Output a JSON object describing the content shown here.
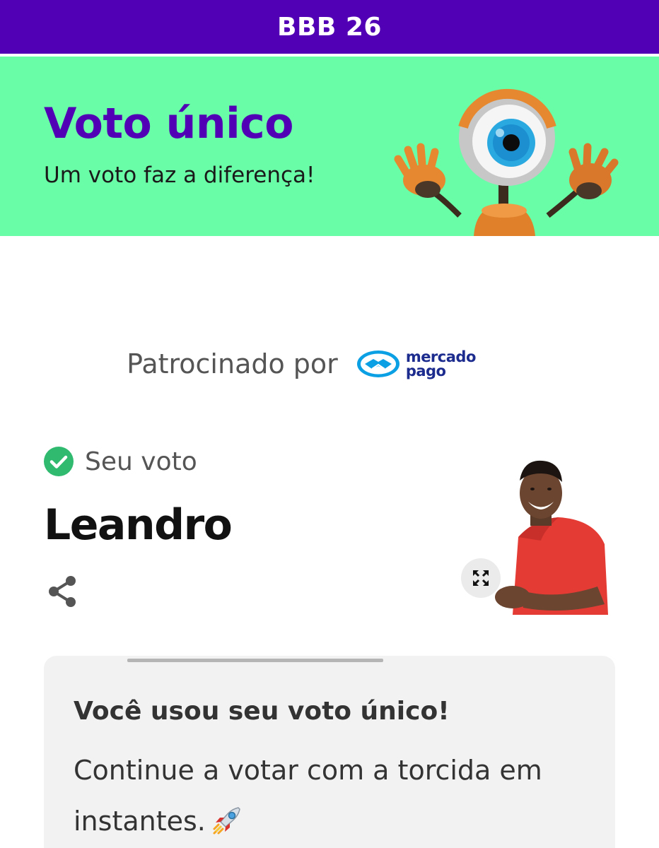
{
  "header": {
    "title": "BBB 26"
  },
  "hero": {
    "title": "Voto único",
    "subtitle": "Um voto faz a diferença!",
    "mascot_icon": "big-brother-eye-mascot"
  },
  "sponsor": {
    "label": "Patrocinado por",
    "brand_line1": "mercado",
    "brand_line2": "pago"
  },
  "vote": {
    "status_label": "Seu voto",
    "status_icon": "check-circle-icon",
    "candidate_name": "Leandro"
  },
  "card": {
    "title": "Você usou seu voto único!",
    "body": "Continue a votar com a torcida em instantes.",
    "body_icon": "rocket-emoji"
  },
  "colors": {
    "brand_purple": "#5200b5",
    "hero_green": "#68fda6",
    "check_green": "#2fba6f",
    "card_bg": "#f2f2f2"
  }
}
